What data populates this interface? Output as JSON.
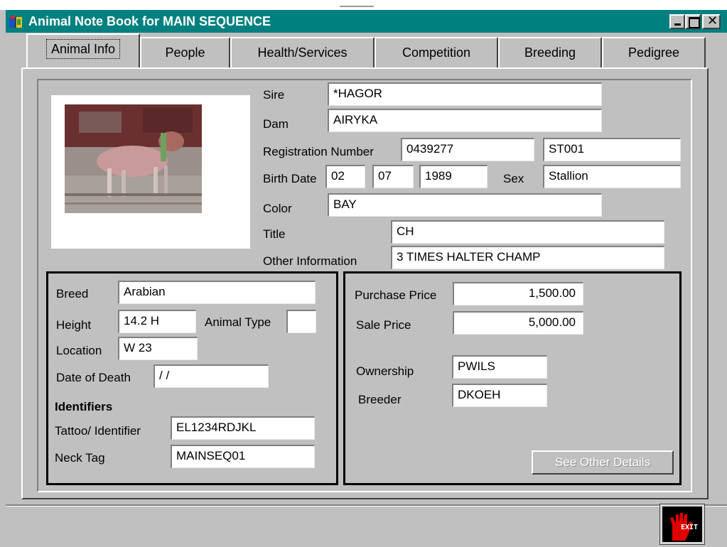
{
  "window": {
    "title": "Animal Note Book for MAIN SEQUENCE"
  },
  "tabs": [
    "Animal Info",
    "People",
    "Health/Services",
    "Competition",
    "Breeding",
    "Pedigree"
  ],
  "active_tab": "Animal Info",
  "labels": {
    "sire": "Sire",
    "dam": "Dam",
    "registration_number": "Registration Number",
    "birth_date": "Birth Date",
    "sex": "Sex",
    "color": "Color",
    "title": "Title",
    "other_information": "Other Information",
    "breed": "Breed",
    "height": "Height",
    "animal_type": "Animal Type",
    "location": "Location",
    "date_of_death": "Date of Death",
    "identifiers_heading": "Identifiers",
    "tattoo_identifier": "Tattoo/ Identifier",
    "neck_tag": "Neck Tag",
    "purchase_price": "Purchase Price",
    "sale_price": "Sale Price",
    "ownership": "Ownership",
    "breeder": "Breeder"
  },
  "fields": {
    "sire": "*HAGOR",
    "dam": "AIRYKA",
    "registration_number": "0439277",
    "registration_code": "ST001",
    "birth_month": "02",
    "birth_day": "07",
    "birth_year": "1989",
    "sex": "Stallion",
    "color": "BAY",
    "title": "CH",
    "other_information": "3 TIMES HALTER CHAMP",
    "breed": "Arabian",
    "height": "14.2 H",
    "animal_type": "",
    "location": "W 23",
    "date_of_death": " / /",
    "tattoo_identifier": "EL1234RDJKL",
    "neck_tag": "MAINSEQ01",
    "purchase_price": "1,500.00",
    "sale_price": "5,000.00",
    "ownership": "PWILS",
    "breeder": "DKOEH"
  },
  "buttons": {
    "see_other_details": "See Other Details",
    "exit": "EXIT"
  },
  "icons": {
    "app": "app-book-icon",
    "minimize": "minimize-icon",
    "maximize": "maximize-icon",
    "close": "close-icon",
    "exit": "exit-hand-icon"
  },
  "colors": {
    "titlebar": "#00807f",
    "face": "#c0c0c0",
    "exit_hand": "#e00000"
  }
}
